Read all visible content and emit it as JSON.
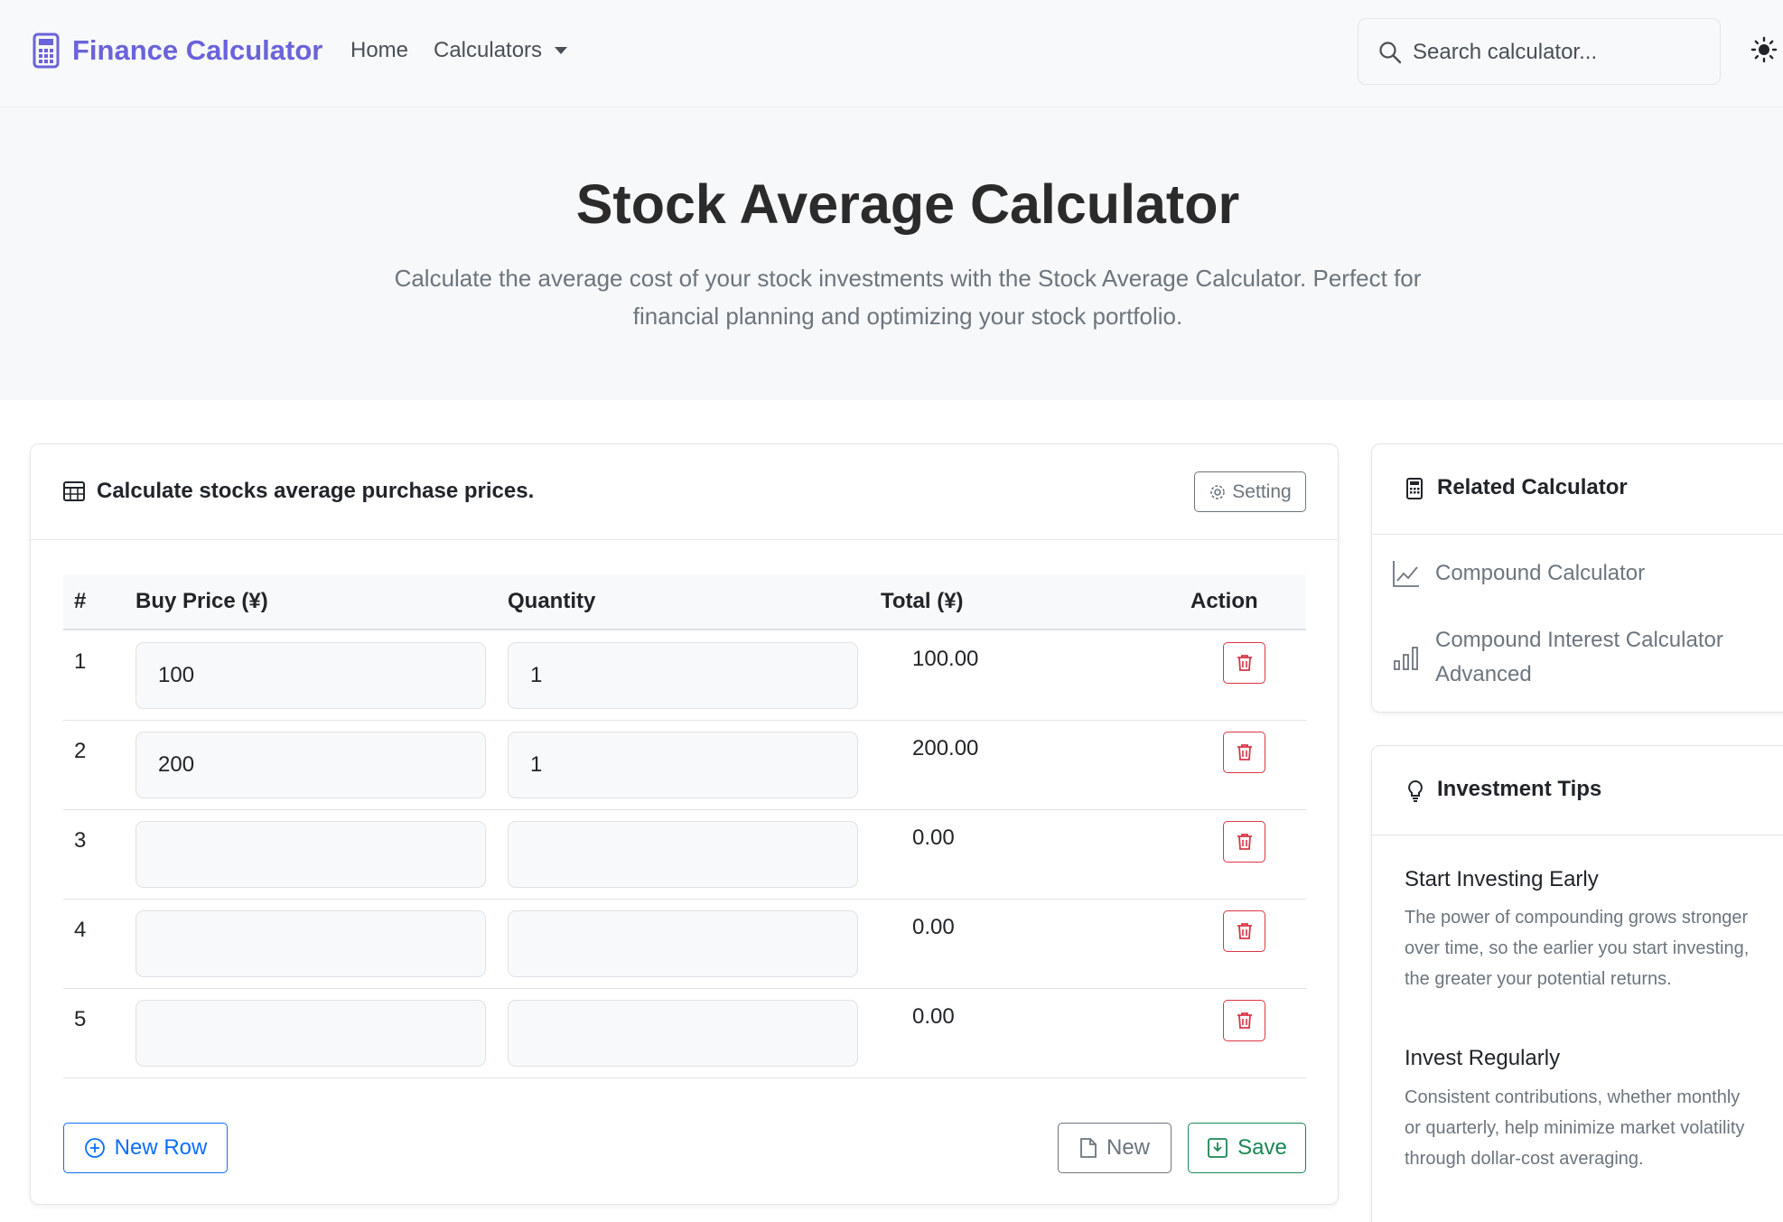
{
  "navbar": {
    "brand": "Finance Calculator",
    "home": "Home",
    "calculators": "Calculators",
    "search_placeholder": "Search calculator..."
  },
  "hero": {
    "title": "Stock Average Calculator",
    "subtitle": "Calculate the average cost of your stock investments with the Stock Average Calculator. Perfect for financial planning and optimizing your stock portfolio."
  },
  "calculator": {
    "title": "Calculate stocks average purchase prices.",
    "setting_label": "Setting",
    "columns": [
      "#",
      "Buy Price (¥)",
      "Quantity",
      "Total (¥)",
      "Action"
    ],
    "rows": [
      {
        "num": "1",
        "price": "100",
        "qty": "1",
        "total": "100.00"
      },
      {
        "num": "2",
        "price": "200",
        "qty": "1",
        "total": "200.00"
      },
      {
        "num": "3",
        "price": "",
        "qty": "",
        "total": "0.00"
      },
      {
        "num": "4",
        "price": "",
        "qty": "",
        "total": "0.00"
      },
      {
        "num": "5",
        "price": "",
        "qty": "",
        "total": "0.00"
      }
    ],
    "new_row_label": "New Row",
    "new_label": "New",
    "save_label": "Save"
  },
  "related": {
    "title": "Related Calculator",
    "items": [
      {
        "label": "Compound Calculator",
        "icon": "line-chart-icon"
      },
      {
        "label": "Compound Interest Calculator Advanced",
        "icon": "bar-chart-icon"
      }
    ]
  },
  "tips": {
    "title": "Investment Tips",
    "items": [
      {
        "heading": "Start Investing Early",
        "body": "The power of compounding grows stronger over time, so the earlier you start investing, the greater your potential returns."
      },
      {
        "heading": "Invest Regularly",
        "body": "Consistent contributions, whether monthly or quarterly, help minimize market volatility through dollar-cost averaging."
      }
    ]
  },
  "colors": {
    "brand": "#6a63d9",
    "primary": "#0d6efd",
    "danger": "#dc3545",
    "success": "#198754",
    "muted": "#6c757d"
  }
}
